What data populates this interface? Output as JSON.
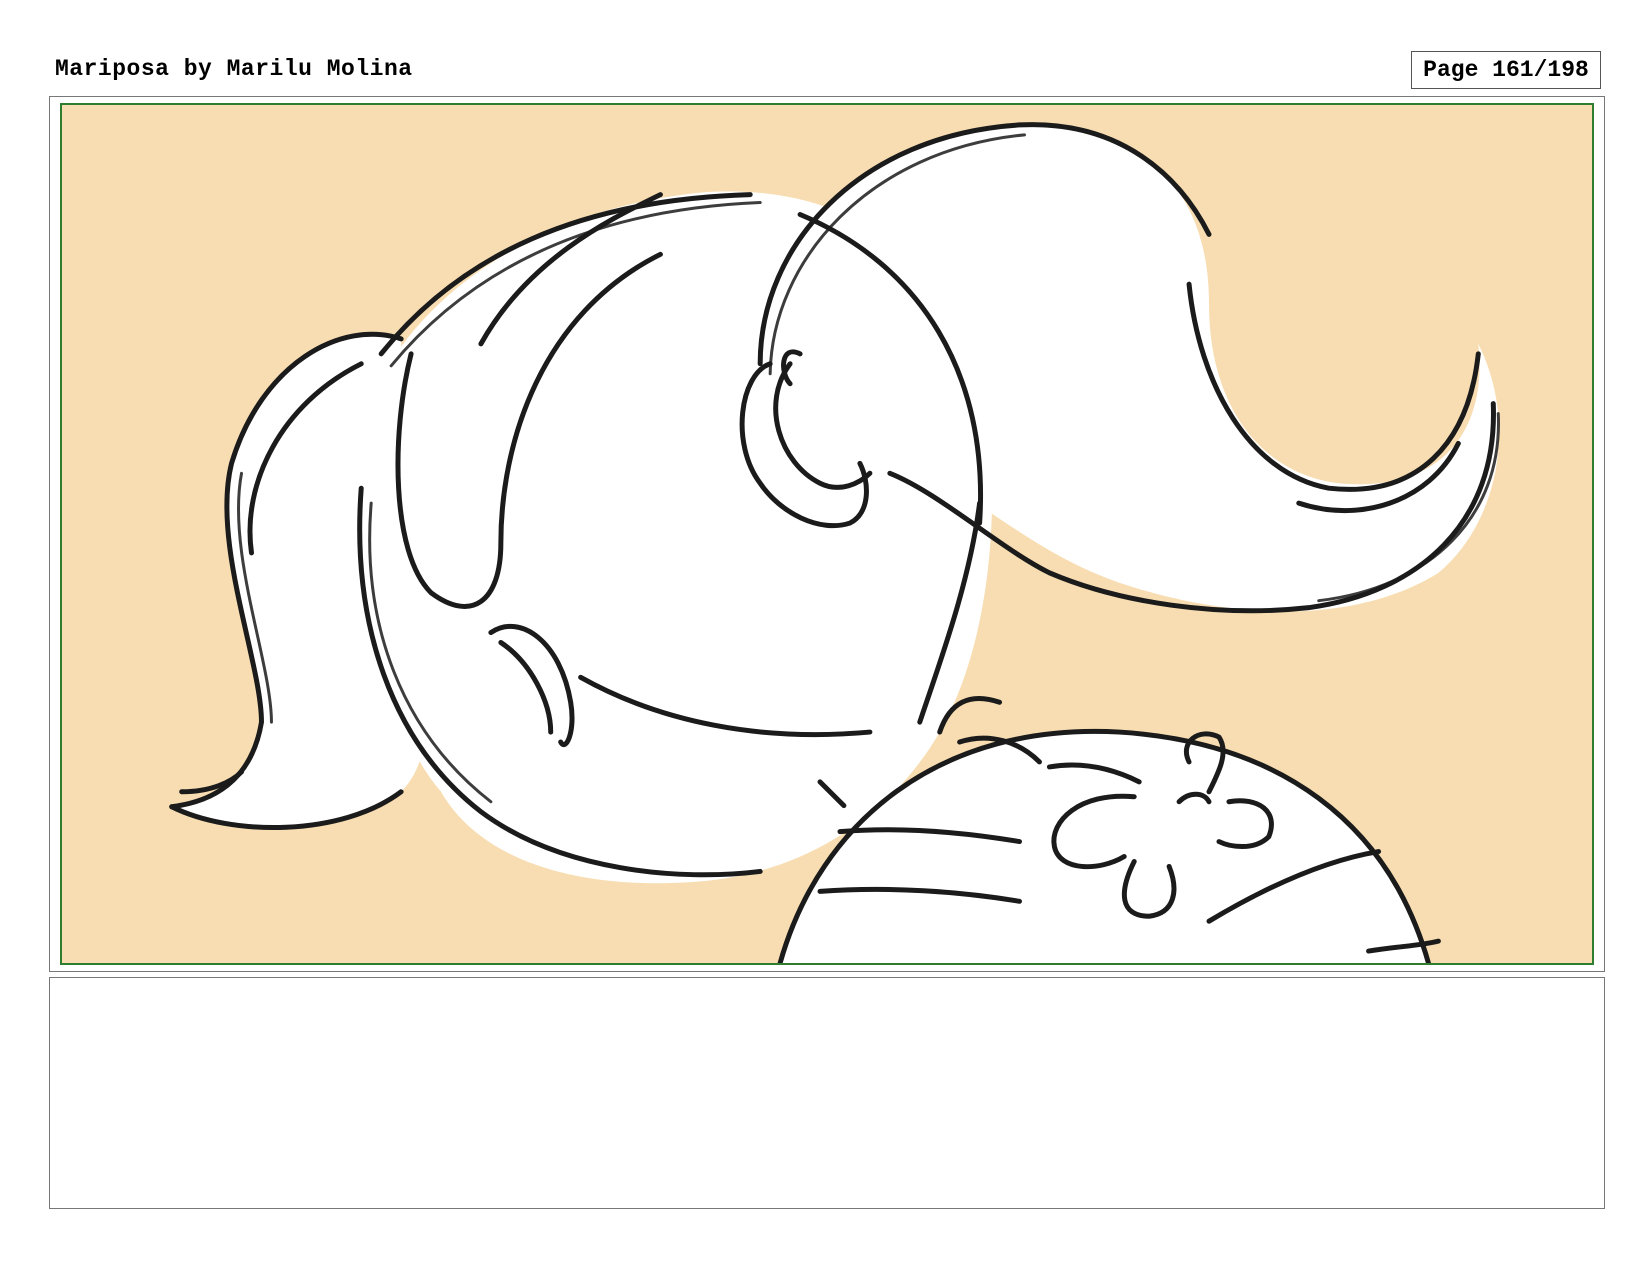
{
  "header": {
    "title": "Mariposa by Marilu Molina",
    "page_label": "Page 161/198"
  },
  "panel": {
    "background_color": "#f7ddb1",
    "border_color": "#2f7d2f",
    "sketch_description_icon": "storyboard-sketch-image"
  },
  "notes": {
    "text": ""
  }
}
